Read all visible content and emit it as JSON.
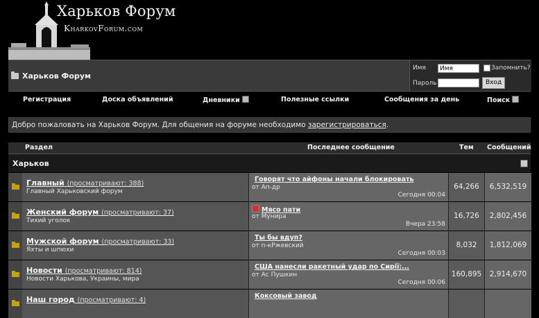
{
  "site": {
    "title": "Харьков Форум",
    "subtitle": "KharkovForum.com"
  },
  "navbar": {
    "forum_name": "Харьков Форум",
    "login": {
      "name_label": "Имя",
      "name_value": "Имя",
      "remember_label": "Запомнить?",
      "password_label": "Пароль",
      "password_value": "",
      "login_button": "Вход"
    }
  },
  "menu": {
    "items": [
      "Регистрация",
      "Доска объявлений",
      "Дневники",
      "Полезные ссылки",
      "Сообщения за день",
      "Поиск"
    ]
  },
  "welcome": {
    "text": "Добро пожаловать на Харьков Форум. Для общения на форуме необходимо ",
    "link": "зарегистрироваться",
    "suffix": "."
  },
  "table": {
    "headers": [
      "Раздел",
      "Последнее сообщение",
      "Тем",
      "Сообщений"
    ],
    "category": "Харьков",
    "rows": [
      {
        "name": "Главный",
        "viewing": "(просматривают: 388)",
        "desc": "Главный Харьковский форум",
        "last_title": "Говорят что айфоны начали блокировать",
        "last_by": "от Ап-др",
        "last_time": "Сегодня 00:04",
        "threads": "64,266",
        "posts": "6,532,519"
      },
      {
        "name": "Женский форум",
        "viewing": "(просматривают: 37)",
        "desc": "Тихий уголок",
        "last_title": "Мясо пати",
        "last_by": "от Мунира",
        "last_time": "Вчера 23:58",
        "threads": "16,726",
        "posts": "2,802,456"
      },
      {
        "name": "Мужской форум",
        "viewing": "(просматривают: 33)",
        "desc": "Яхты и шпюхи",
        "last_title": "Ты бы вдуп?",
        "last_by": "от п-кРжевский",
        "last_time": "Сегодня 00:03",
        "threads": "8,032",
        "posts": "1,812,069"
      },
      {
        "name": "Новости",
        "viewing": "(просматривают: 814)",
        "desc": "Новости Харькова, Украины, мира",
        "last_title": "США нанесли ракетный удар по Сирії:...",
        "last_by": "от Ас Пушкин",
        "last_time": "Сегодня 00:06",
        "threads": "160,895",
        "posts": "2,914,670"
      },
      {
        "name": "Наш город",
        "viewing": "(просматривают: 4)",
        "desc": "",
        "last_title": "Коксовый завод",
        "last_by": "",
        "last_time": "",
        "threads": "",
        "posts": ""
      }
    ]
  }
}
